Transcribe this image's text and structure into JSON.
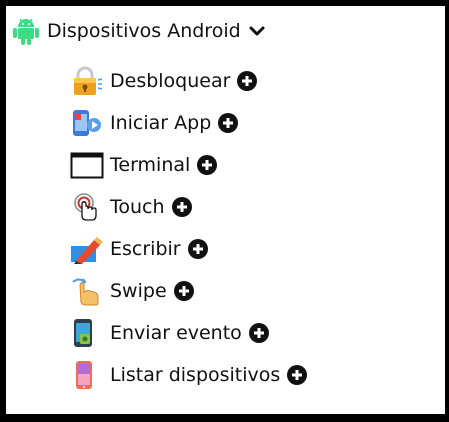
{
  "group": {
    "title": "Dispositivos Android",
    "icon": "android-icon",
    "expand_icon": "chevron-down-icon"
  },
  "items": [
    {
      "label": "Desbloquear",
      "icon": "padlock-icon"
    },
    {
      "label": "Iniciar App",
      "icon": "launch-app-icon"
    },
    {
      "label": "Terminal",
      "icon": "terminal-window-icon"
    },
    {
      "label": "Touch",
      "icon": "touch-finger-icon"
    },
    {
      "label": "Escribir",
      "icon": "pencil-write-icon"
    },
    {
      "label": "Swipe",
      "icon": "swipe-hand-icon"
    },
    {
      "label": "Enviar evento",
      "icon": "phone-event-icon"
    },
    {
      "label": "Listar dispositivos",
      "icon": "phone-list-icon"
    }
  ],
  "add_icon": "plus-circle-icon",
  "colors": {
    "android_green": "#3ddc84",
    "text": "#111111",
    "border": "#000000"
  }
}
